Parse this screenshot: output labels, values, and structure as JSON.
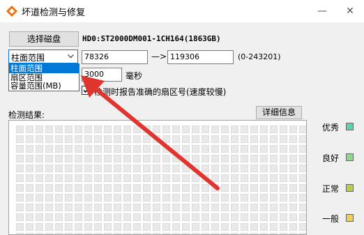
{
  "window": {
    "title": "坏道检测与修复",
    "controls": {
      "minimize": "—",
      "close": "✕"
    }
  },
  "disk": {
    "select_button": "选择磁盘",
    "info": "HD0:ST2000DM001-1CH164(1863GB)"
  },
  "range": {
    "selected": "柱面范围",
    "options": [
      "柱面范围",
      "扇区范围",
      "容量范围(MB)"
    ],
    "start": "78326",
    "arrow": "—>",
    "end": "119306",
    "limit": "(0-243201)"
  },
  "timeout": {
    "value": "3000",
    "unit": "毫秒"
  },
  "accurate_report": {
    "checked": true,
    "label": "检测时报告准确的扇区号(速度较慢)"
  },
  "results": {
    "label": "检测结果:",
    "detail_button": "详细信息"
  },
  "legend": [
    {
      "label": "优秀",
      "color": "#5fd3a8"
    },
    {
      "label": "良好",
      "color": "#8fd98a"
    },
    {
      "label": "正常",
      "color": "#b6cf4a"
    },
    {
      "label": "一般",
      "color": "#e8d060"
    }
  ],
  "colors": {
    "arrow": "#e0352f",
    "selection": "#0078d7",
    "grid_cell": "#e9e9e9"
  }
}
